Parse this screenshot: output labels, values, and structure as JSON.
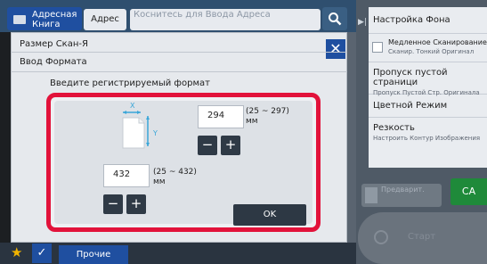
{
  "topbar": {
    "address_book_label": "Адресная Книга",
    "address_label": "Адрес",
    "address_placeholder": "Коснитесь для Ввода Адреса"
  },
  "right_panel": {
    "items": [
      {
        "label": "Настройка Фона",
        "sub": ""
      },
      {
        "label": "Медленное Сканирование",
        "sub": "Сканир. Тонкий Оригинал"
      },
      {
        "label": "Пропуск пустой страници",
        "sub": "Пропуск Пустой Стр. Оригинала"
      },
      {
        "label": "Цветной Режим",
        "sub": ""
      },
      {
        "label": "Резкость",
        "sub": "Настроить Контур Изображения"
      }
    ],
    "preview_label": "Предварит.",
    "ca_label": "CA",
    "start_label": "Старт"
  },
  "dialog": {
    "title": "Размер Скан-Я",
    "subtitle": "Ввод Формата",
    "instruction": "Введите регистрируемый формат",
    "x_axis_label": "X",
    "y_axis_label": "Y",
    "y_value": "294",
    "y_range": "(25 ~ 297)",
    "y_unit": "мм",
    "x_value": "432",
    "x_range": "(25 ~ 432)",
    "x_unit": "мм",
    "minus_label": "−",
    "plus_label": "+",
    "ok_label": "OK",
    "close_label": "✕"
  },
  "bottombar": {
    "star_label": "★",
    "check_label": "✓",
    "more_label": "Прочие"
  },
  "colors": {
    "accent_blue": "#1f4fa0",
    "highlight_red": "#e2123a",
    "ca_green": "#1f8a3a",
    "star_yellow": "#f2b400"
  }
}
